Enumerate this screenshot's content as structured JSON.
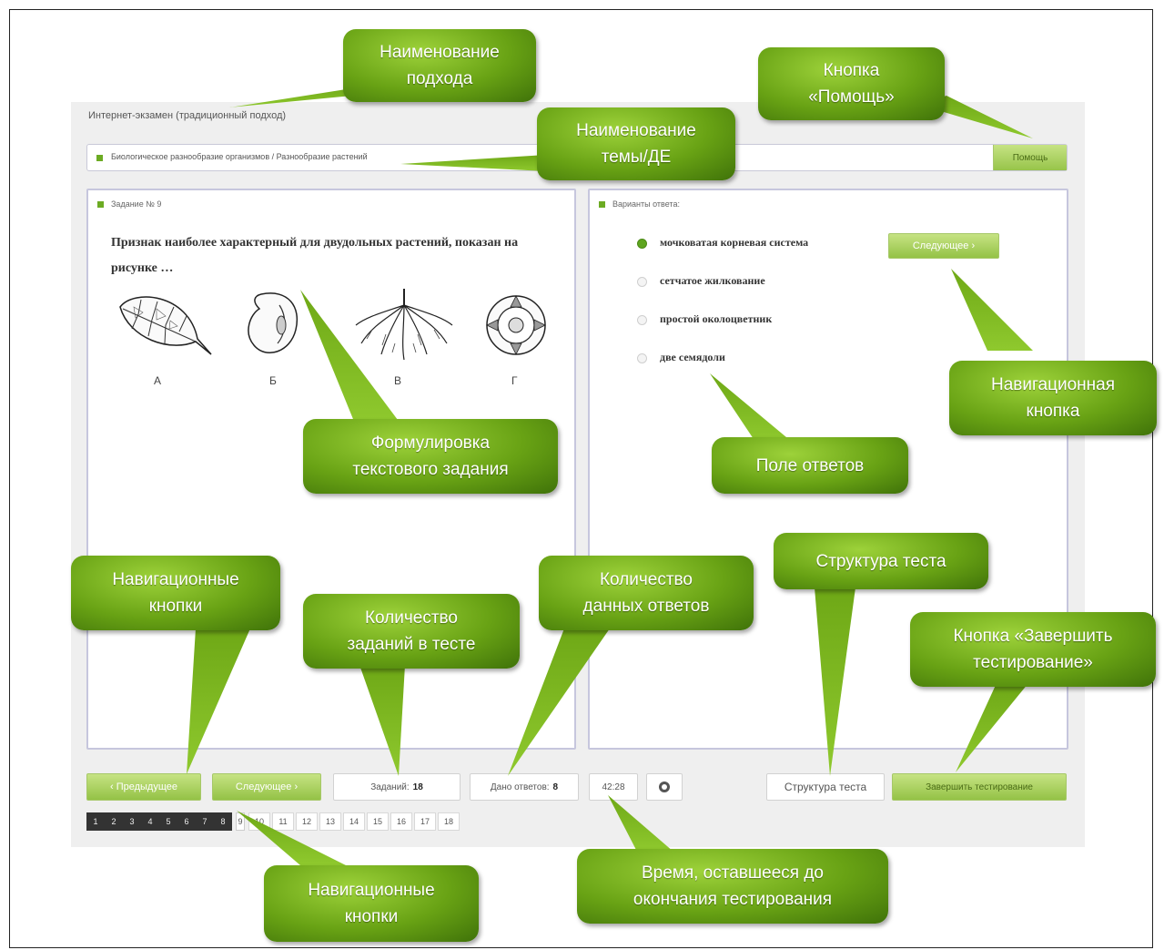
{
  "app": {
    "approach_title": "Интернет-экзамен (традиционный подход)",
    "topic": "Биологическое разнообразие организмов / Разнообразие растений",
    "help_label": "Помощь"
  },
  "task": {
    "header": "Задание № 9",
    "text": "Признак наиболее характерный для двудольных растений, показан на рисунке …",
    "figure_labels": [
      "А",
      "Б",
      "В",
      "Г"
    ]
  },
  "answers": {
    "header": "Варианты ответа:",
    "options": [
      {
        "label": "мочковатая корневая система",
        "selected": true
      },
      {
        "label": "сетчатое жилкование",
        "selected": false
      },
      {
        "label": "простой околоцветник",
        "selected": false
      },
      {
        "label": "две семядоли",
        "selected": false
      }
    ],
    "next_label": "Следующее"
  },
  "footer": {
    "prev_label": "Предыдущее",
    "next_label": "Следующее",
    "tasks_label": "Заданий:",
    "tasks_value": "18",
    "answers_label": "Дано ответов:",
    "answers_value": "8",
    "timer": "42:28",
    "structure_label": "Структура теста",
    "finish_label": "Завершить тестирование"
  },
  "pager": {
    "answered": [
      "1",
      "2",
      "3",
      "4",
      "5",
      "6",
      "7",
      "8"
    ],
    "current": "9",
    "remaining": [
      "10",
      "11",
      "12",
      "13",
      "14",
      "15",
      "16",
      "17",
      "18"
    ]
  },
  "callouts": {
    "approach": "Наименование\nподхода",
    "help": "Кнопка\n«Помощь»",
    "topic": "Наименование\nтемы/ДЕ",
    "task_text": "Формулировка\nтекстового задания",
    "nav_button": "Навигационная\nкнопка",
    "answer_field": "Поле ответов",
    "nav_buttons": "Навигационные\nкнопки",
    "task_count": "Количество\nзаданий в тесте",
    "answer_count": "Количество\nданных ответов",
    "structure": "Структура теста",
    "finish": "Кнопка «Завершить\nтестирование»",
    "pager_nav": "Навигационные\nкнопки",
    "time_left": "Время, оставшееся до\nокончания тестирования"
  },
  "colors": {
    "accent_green": "#6cab23",
    "callout_green": "#68a214",
    "panel_border": "#c6c6dd"
  }
}
